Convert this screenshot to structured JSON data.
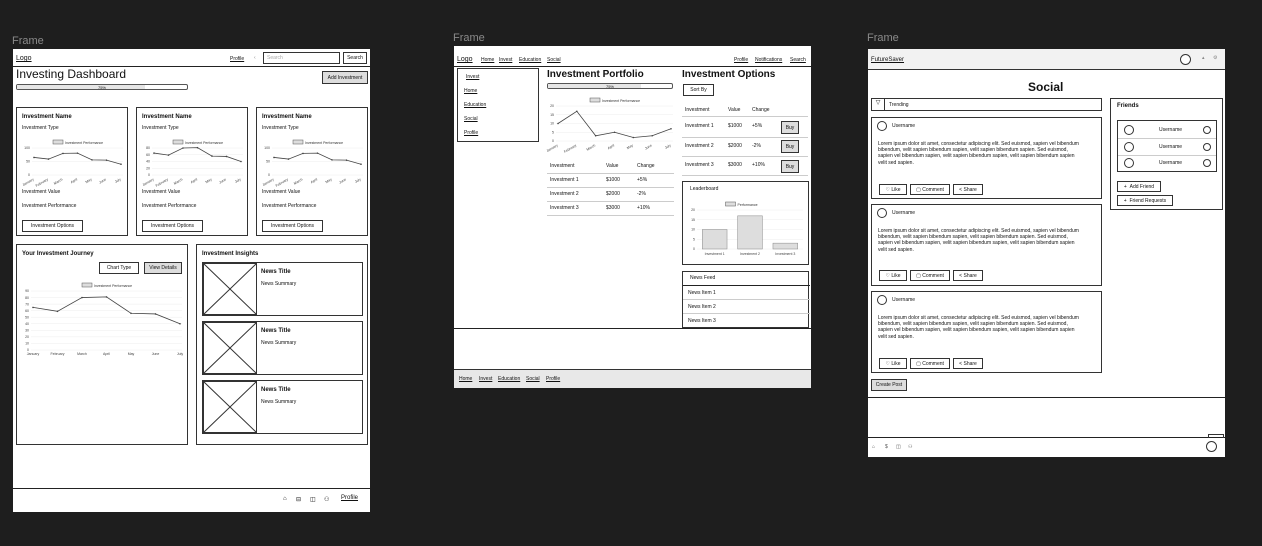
{
  "canvas": {
    "frame_labels": [
      "Frame",
      "Frame",
      "Frame"
    ]
  },
  "dashboard": {
    "logo": "Logo",
    "profile_link": "Profile",
    "search_placeholder": "Search",
    "search_button": "Search",
    "title": "Investing Dashboard",
    "add_button": "Add Investment",
    "progress_label": "75%",
    "cards": [
      {
        "name": "Investment Name",
        "type": "Investment Type",
        "value": "Investment Value",
        "performance": "Investment Performance",
        "options": "Investment Options"
      },
      {
        "name": "Investment Name",
        "type": "Investment Type",
        "value": "Investment Value",
        "performance": "Investment Performance",
        "options": "Investment Options"
      },
      {
        "name": "Investment Name",
        "type": "Investment Type",
        "value": "Investment Value",
        "performance": "Investment Performance",
        "options": "Investment Options"
      }
    ],
    "journey": {
      "title": "Your Investment Journey",
      "chart_type": "Chart Type",
      "view_details": "View Details"
    },
    "insights": {
      "title": "Investment Insights",
      "items": [
        {
          "title": "News Title",
          "summary": "News Summary"
        },
        {
          "title": "News Title",
          "summary": "News Summary"
        },
        {
          "title": "News Title",
          "summary": "News Summary"
        }
      ]
    },
    "footer_profile": "Profile"
  },
  "portfolio": {
    "logo": "Logo",
    "nav": [
      "Home",
      "Invest",
      "Education",
      "Social"
    ],
    "right_nav": [
      "Profile",
      "Notifications",
      "Search"
    ],
    "side_menu": [
      "Invest",
      "Home",
      "Education",
      "Social",
      "Profile"
    ],
    "title": "Investment Portfolio",
    "progress_label": "75%",
    "table_headers": [
      "Investment",
      "Value",
      "Change"
    ],
    "table_rows": [
      [
        "Investment 1",
        "$1000",
        "+5%"
      ],
      [
        "Investment 2",
        "$2000",
        "-2%"
      ],
      [
        "Investment 3",
        "$3000",
        "+10%"
      ]
    ],
    "options": {
      "title": "Investment Options",
      "sort_by": "Sort By",
      "headers": [
        "Investment",
        "Value",
        "Change"
      ],
      "rows": [
        [
          "Investment 1",
          "$1000",
          "+5%"
        ],
        [
          "Investment 2",
          "$2000",
          "-2%"
        ],
        [
          "Investment 3",
          "$3000",
          "+10%"
        ]
      ],
      "buy": "Buy"
    },
    "leaderboard": "Leaderboard",
    "news_feed": {
      "title": "News Feed",
      "items": [
        "News Item 1",
        "News Item 2",
        "News Item 3"
      ]
    },
    "footer_nav": [
      "Home",
      "Invest",
      "Education",
      "Social",
      "Profile"
    ]
  },
  "social": {
    "brand": "FutureSaver",
    "title": "Social",
    "trending": "Trending",
    "posts": [
      {
        "username": "Username",
        "body": "Lorem ipsum dolor sit amet, consectetur adipiscing elit. Sed euismod, sapien vel bibendum bibendum, velit sapien bibendum sapien, velit sapien bibendum sapien. Sed euismod, sapien vel bibendum sapien, velit sapien bibendum sapien, velit sapien bibendum sapien velit sed sapien."
      },
      {
        "username": "Username",
        "body": "Lorem ipsum dolor sit amet, consectetur adipiscing elit. Sed euismod, sapien vel bibendum bibendum, velit sapien bibendum sapien, velit sapien bibendum sapien. Sed euismod, sapien vel bibendum sapien, velit sapien bibendum sapien, velit sapien bibendum sapien velit sed sapien."
      },
      {
        "username": "Username",
        "body": "Lorem ipsum dolor sit amet, consectetur adipiscing elit. Sed euismod, sapien vel bibendum bibendum, velit sapien bibendum sapien, velit sapien bibendum sapien. Sed euismod, sapien vel bibendum sapien, velit sapien bibendum sapien, velit sapien bibendum sapien velit sed sapien."
      }
    ],
    "like": "Like",
    "comment": "Comment",
    "share": "Share",
    "create_post": "Create Post",
    "friends": {
      "title": "Friends",
      "list": [
        "Username",
        "Username",
        "Username"
      ],
      "add": "Add Friend",
      "requests": "Friend Requests"
    }
  },
  "chart_data": [
    {
      "type": "line",
      "legend": "Investment Performance",
      "categories": [
        "January",
        "February",
        "March",
        "April",
        "May",
        "June",
        "July"
      ],
      "values": [
        65,
        59,
        80,
        81,
        56,
        55,
        40
      ],
      "ylim": [
        0,
        100
      ],
      "yticks": [
        0,
        50,
        100
      ]
    },
    {
      "type": "line",
      "legend": "Investment Performance",
      "categories": [
        "January",
        "February",
        "March",
        "April",
        "May",
        "June",
        "July"
      ],
      "values": [
        65,
        59,
        80,
        81,
        56,
        55,
        40
      ],
      "ylim": [
        0,
        80
      ],
      "yticks": [
        0,
        20,
        40,
        60,
        80
      ]
    },
    {
      "type": "line",
      "legend": "Investment Performance",
      "categories": [
        "January",
        "February",
        "March",
        "April",
        "May",
        "June",
        "July"
      ],
      "values": [
        65,
        59,
        80,
        81,
        56,
        55,
        40
      ],
      "ylim": [
        0,
        100
      ],
      "yticks": [
        0,
        50,
        100
      ]
    },
    {
      "type": "line",
      "legend": "Investment Performance",
      "categories": [
        "January",
        "February",
        "March",
        "April",
        "May",
        "June",
        "July"
      ],
      "values": [
        65,
        59,
        80,
        81,
        56,
        55,
        40
      ],
      "ylim": [
        0,
        90
      ],
      "yticks": [
        0,
        10,
        20,
        30,
        40,
        50,
        60,
        70,
        80,
        90
      ]
    },
    {
      "type": "line",
      "legend": "Investment Performance",
      "categories": [
        "January",
        "February",
        "March",
        "April",
        "May",
        "June",
        "July"
      ],
      "values": [
        10,
        17,
        3,
        5,
        2,
        3,
        7
      ],
      "ylim": [
        0,
        20
      ],
      "yticks": [
        0,
        5,
        10,
        15,
        20
      ]
    },
    {
      "type": "bar",
      "legend": "Performance",
      "categories": [
        "Investment 1",
        "Investment 2",
        "Investment 3"
      ],
      "values": [
        10,
        17,
        3
      ],
      "ylim": [
        0,
        20
      ],
      "yticks": [
        0,
        5,
        10,
        15,
        20
      ]
    }
  ]
}
